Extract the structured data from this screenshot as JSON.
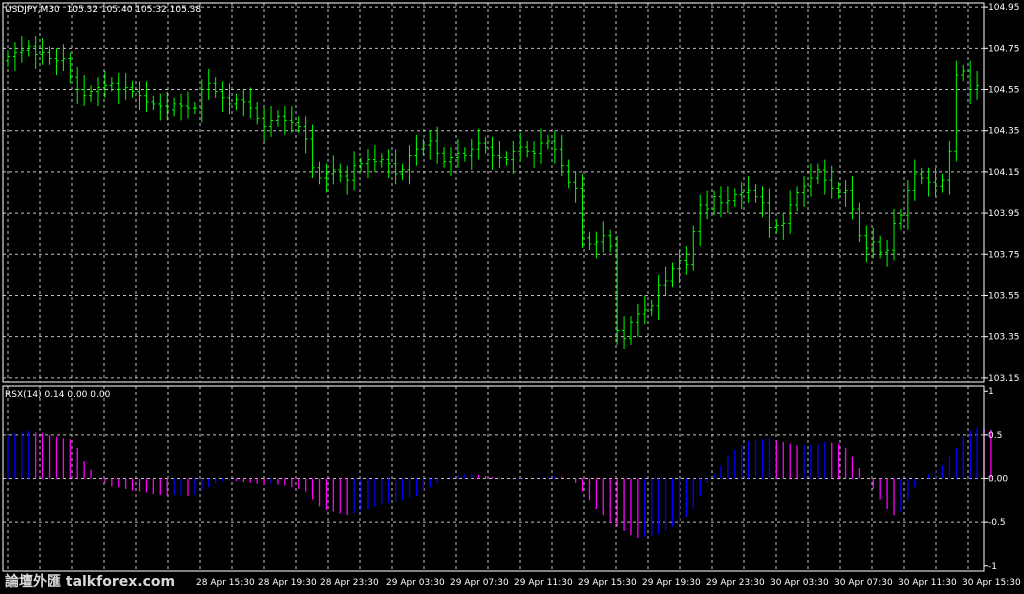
{
  "header": {
    "symbol": "USDJPY,M30",
    "ohlc": "105.32 105.40 105.32 105.38"
  },
  "indicator": {
    "label": "RSX(14) 0.14 0.00 0.00"
  },
  "watermark": "論壇外匯 talkforex.com",
  "colors": {
    "background": "#000000",
    "grid": "#c0c0c0",
    "price_bars": "#00ff00",
    "rsx_positive": "#0000ff",
    "rsx_negative": "#ff00ff",
    "text": "#ffffff"
  },
  "chart_data": [
    {
      "type": "ohlc",
      "name": "price",
      "yticks": [
        "104.95",
        "104.75",
        "104.55",
        "104.35",
        "104.15",
        "103.95",
        "103.75",
        "103.55",
        "103.35",
        "103.15"
      ],
      "ylim": [
        103.13,
        104.97
      ],
      "xticks": [
        "28 Apr 15:30",
        "28 Apr 19:30",
        "28 Apr 23:30",
        "29 Apr 03:30",
        "29 Apr 07:30",
        "29 Apr 11:30",
        "29 Apr 15:30",
        "29 Apr 19:30",
        "29 Apr 23:30",
        "30 Apr 03:30",
        "30 Apr 07:30",
        "30 Apr 11:30",
        "30 Apr 15:30"
      ],
      "grid": true,
      "close": [
        104.71,
        104.73,
        104.74,
        104.76,
        104.72,
        104.73,
        104.7,
        104.69,
        104.7,
        104.61,
        104.55,
        104.52,
        104.54,
        104.56,
        104.57,
        104.58,
        104.55,
        104.56,
        104.54,
        104.52,
        104.49,
        104.48,
        104.47,
        104.45,
        104.48,
        104.47,
        104.46,
        104.46,
        104.55,
        104.58,
        104.54,
        104.51,
        104.48,
        104.5,
        104.49,
        104.46,
        104.41,
        104.37,
        104.4,
        104.42,
        104.4,
        104.39,
        104.37,
        104.31,
        104.17,
        104.12,
        104.14,
        104.16,
        104.13,
        104.11,
        104.18,
        104.19,
        104.21,
        104.2,
        104.21,
        104.19,
        104.14,
        104.16,
        104.23,
        104.26,
        104.28,
        104.3,
        104.24,
        104.2,
        104.22,
        104.24,
        104.23,
        104.26,
        104.29,
        104.27,
        104.23,
        104.22,
        104.21,
        104.25,
        104.27,
        104.25,
        104.24,
        104.29,
        104.3,
        104.26,
        104.18,
        104.1,
        104.07,
        103.83,
        103.8,
        103.81,
        103.84,
        103.79,
        103.38,
        103.34,
        103.42,
        103.46,
        103.48,
        103.5,
        103.6,
        103.62,
        103.68,
        103.72,
        103.7,
        103.86,
        103.99,
        103.97,
        104.03,
        104.0,
        104.01,
        104.04,
        104.05,
        104.06,
        104.03,
        104.0,
        103.88,
        103.89,
        103.9,
        103.99,
        104.05,
        104.08,
        104.12,
        104.16,
        104.11,
        104.07,
        104.05,
        104.06,
        103.97,
        103.84,
        103.78,
        103.81,
        103.76,
        103.77,
        103.9,
        103.94,
        104.06,
        104.14,
        104.12,
        104.1,
        104.08,
        104.11,
        104.25,
        104.62,
        104.64,
        104.55,
        104.57
      ]
    },
    {
      "type": "histogram",
      "name": "RSX(14)",
      "yticks": [
        "1",
        "0.5",
        "0.00",
        "-0.5",
        "-1"
      ],
      "ylim": [
        -1.06,
        1.06
      ],
      "levels": [
        0.5,
        0.0,
        -0.5
      ],
      "values": [
        0.5,
        0.52,
        0.54,
        0.55,
        0.53,
        0.52,
        0.5,
        0.48,
        0.46,
        0.45,
        0.35,
        0.2,
        0.1,
        0.0,
        -0.05,
        -0.09,
        -0.1,
        -0.12,
        -0.14,
        -0.15,
        -0.16,
        -0.18,
        -0.19,
        -0.2,
        -0.19,
        -0.19,
        -0.2,
        -0.19,
        -0.15,
        -0.1,
        -0.06,
        -0.03,
        -0.02,
        -0.03,
        -0.04,
        -0.05,
        -0.06,
        -0.07,
        -0.06,
        -0.07,
        -0.08,
        -0.1,
        -0.12,
        -0.15,
        -0.24,
        -0.32,
        -0.36,
        -0.38,
        -0.4,
        -0.42,
        -0.4,
        -0.37,
        -0.35,
        -0.32,
        -0.3,
        -0.28,
        -0.27,
        -0.25,
        -0.22,
        -0.2,
        -0.15,
        -0.1,
        -0.05,
        0.0,
        0.02,
        0.04,
        0.05,
        0.05,
        0.04,
        0.03,
        0.02,
        0.01,
        0.0,
        -0.01,
        -0.01,
        0.0,
        0.0,
        0.01,
        0.02,
        0.03,
        0.02,
        0.0,
        -0.05,
        -0.15,
        -0.25,
        -0.35,
        -0.42,
        -0.5,
        -0.55,
        -0.6,
        -0.65,
        -0.68,
        -0.67,
        -0.66,
        -0.64,
        -0.6,
        -0.55,
        -0.5,
        -0.44,
        -0.35,
        -0.2,
        -0.05,
        0.05,
        0.15,
        0.25,
        0.33,
        0.38,
        0.43,
        0.44,
        0.45,
        0.46,
        0.44,
        0.42,
        0.4,
        0.38,
        0.38,
        0.39,
        0.4,
        0.42,
        0.41,
        0.4,
        0.35,
        0.25,
        0.12,
        0.0,
        -0.12,
        -0.24,
        -0.35,
        -0.42,
        -0.38,
        -0.25,
        -0.1,
        0.0,
        0.05,
        0.1,
        0.15,
        0.25,
        0.35,
        0.48,
        0.55,
        0.58,
        0.57,
        0.56
      ]
    }
  ]
}
